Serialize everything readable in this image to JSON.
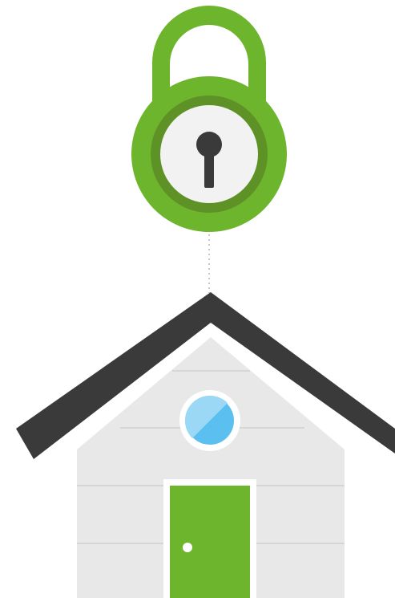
{
  "illustration": {
    "lock_icon": "padlock-icon",
    "house_icon": "house-icon",
    "colors": {
      "background": "#ffffff",
      "lock_green": "#6db52d",
      "lock_ring_dark": "#5e9227",
      "lock_face": "#f2f2f2",
      "keyhole": "#3a3a3a",
      "connector_dots": "#c8c8c8",
      "roof": "#3a3a3a",
      "roof_underside": "#ffffff",
      "siding": "#e8e8e8",
      "siding_lines": "#d8d8d8",
      "window_frame": "#ffffff",
      "window_glass": "#5bbfef",
      "window_glass_light": "#9ad8f5",
      "door": "#6db52d",
      "door_frame": "#ffffff",
      "door_knob": "#ffffff"
    }
  }
}
